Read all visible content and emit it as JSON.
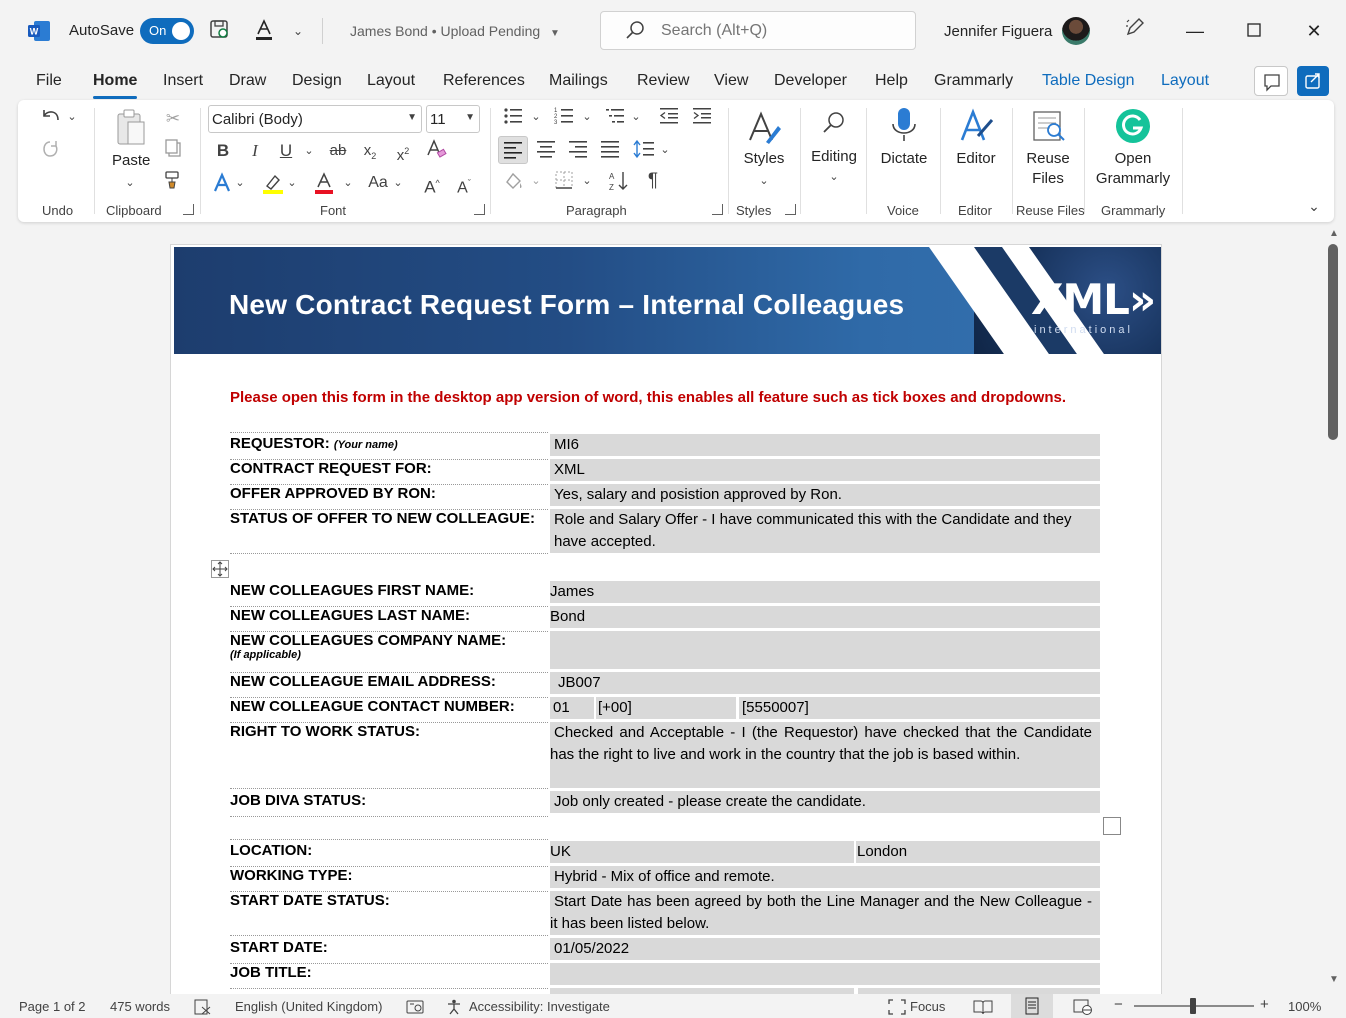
{
  "titlebar": {
    "autosave_label": "AutoSave",
    "autosave_state": "On",
    "doc_title": "James Bond",
    "doc_status": "• Upload Pending",
    "search_placeholder": "Search (Alt+Q)",
    "user_name": "Jennifer Figuera"
  },
  "tabs": [
    {
      "label": "File"
    },
    {
      "label": "Home"
    },
    {
      "label": "Insert"
    },
    {
      "label": "Draw"
    },
    {
      "label": "Design"
    },
    {
      "label": "Layout"
    },
    {
      "label": "References"
    },
    {
      "label": "Mailings"
    },
    {
      "label": "Review"
    },
    {
      "label": "View"
    },
    {
      "label": "Developer"
    },
    {
      "label": "Help"
    },
    {
      "label": "Grammarly"
    },
    {
      "label": "Table Design"
    },
    {
      "label": "Layout"
    }
  ],
  "ribbon": {
    "groups": {
      "undo": "Undo",
      "clipboard": "Clipboard",
      "font": "Font",
      "paragraph": "Paragraph",
      "styles": "Styles",
      "voice": "Voice",
      "editor": "Editor",
      "reuse_files": "Reuse Files",
      "grammarly": "Grammarly"
    },
    "paste": "Paste",
    "font_name": "Calibri (Body)",
    "font_size": "11",
    "styles_btn": "Styles",
    "editing_btn": "Editing",
    "dictate_btn": "Dictate",
    "editor_btn": "Editor",
    "reuse_line1": "Reuse",
    "reuse_line2": "Files",
    "open_line1": "Open",
    "open_line2": "Grammarly"
  },
  "document": {
    "banner_title": "New Contract Request Form – Internal Colleagues",
    "logo_text": "XML»",
    "logo_sub": "international",
    "notice": "Please open this form in the desktop app version of word, this enables all feature such as tick boxes and dropdowns.",
    "rows": {
      "requestor_label": "REQUESTOR:",
      "requestor_hint": "(Your name)",
      "requestor_value": "MI6",
      "contract_for_label": "CONTRACT REQUEST FOR:",
      "contract_for_value": "XML",
      "approved_label": "OFFER APPROVED BY RON:",
      "approved_value": "Yes, salary and posistion approved by Ron.",
      "status_label": "STATUS OF OFFER TO NEW COLLEAGUE:",
      "status_value": "Role and Salary Offer - I have communicated this with the Candidate and they have accepted.",
      "first_name_label": "NEW COLLEAGUES FIRST NAME:",
      "first_name_value": "James",
      "last_name_label": "NEW COLLEAGUES LAST NAME:",
      "last_name_value": "Bond",
      "company_label": "NEW COLLEAGUES COMPANY NAME:",
      "company_hint": "(If applicable)",
      "company_value": "",
      "email_label": "NEW COLLEAGUE EMAIL ADDRESS:",
      "email_value": "JB007",
      "contact_label": "NEW COLLEAGUE CONTACT NUMBER:",
      "contact_part1": "01",
      "contact_part2": "[+00]",
      "contact_part3": "[5550007]",
      "rtw_label": "RIGHT TO WORK STATUS:",
      "rtw_value": "Checked and Acceptable - I (the Requestor) have checked that the Candidate has the right to live and work in the country that the job is based within.",
      "jobdiva_label": "JOB DIVA STATUS:",
      "jobdiva_value": "Job only created - please create the candidate.",
      "location_label": "LOCATION:",
      "location_country": "UK",
      "location_city": "London",
      "working_type_label": "WORKING TYPE:",
      "working_type_value": "Hybrid - Mix of office and remote.",
      "start_status_label": "START DATE STATUS:",
      "start_status_value": "Start Date has been agreed by both the Line Manager and the New Colleague - it has been listed below.",
      "start_date_label": "START DATE:",
      "start_date_value": "01/05/2022",
      "job_title_label": "JOB TITLE:",
      "job_title_value": ""
    }
  },
  "statusbar": {
    "page": "Page 1 of 2",
    "words": "475 words",
    "language": "English (United Kingdom)",
    "accessibility": "Accessibility: Investigate",
    "focus": "Focus",
    "zoom": "100%"
  },
  "colors": {
    "accent": "#0f6cbd",
    "notice_red": "#c00000",
    "field_gray": "#d9d9d9",
    "banner_blue": "#234d85"
  }
}
